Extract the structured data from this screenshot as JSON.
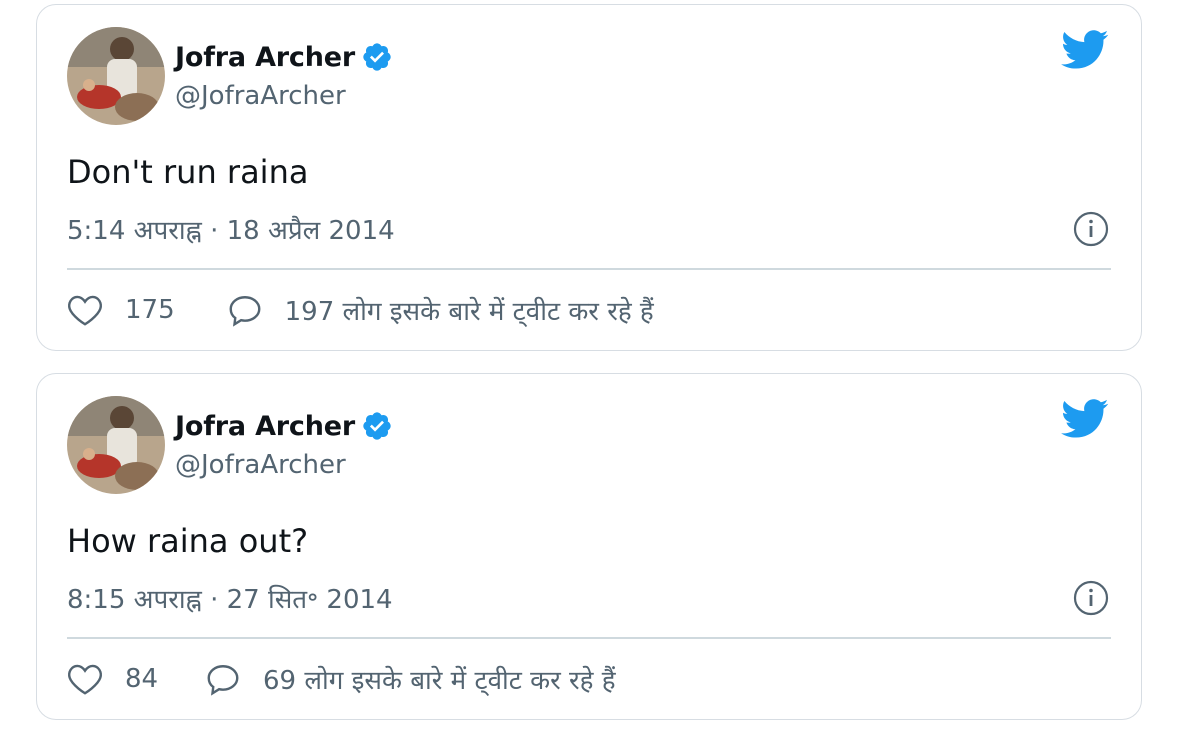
{
  "colors": {
    "twitter_blue": "#1d9bf0",
    "name_text": "#0f1419",
    "secondary_text": "#536471",
    "border": "#d7dde3"
  },
  "tweets": [
    {
      "author_name": "Jofra Archer",
      "author_handle": "@JofraArcher",
      "verified": true,
      "text": "Don't run raina",
      "timestamp": "5:14 अपराह्न · 18 अप्रैल 2014",
      "likes": "175",
      "discussion": "197 लोग इसके बारे में ट्वीट कर रहे हैं",
      "icons": [
        "twitter-bird-icon",
        "verified-badge-icon",
        "info-icon",
        "heart-icon",
        "comment-icon"
      ]
    },
    {
      "author_name": "Jofra Archer",
      "author_handle": "@JofraArcher",
      "verified": true,
      "text": "How raina out?",
      "timestamp": "8:15 अपराह्न · 27 सित॰ 2014",
      "likes": "84",
      "discussion": "69 लोग इसके बारे में ट्वीट कर रहे हैं",
      "icons": [
        "twitter-bird-icon",
        "verified-badge-icon",
        "info-icon",
        "heart-icon",
        "comment-icon"
      ]
    }
  ]
}
